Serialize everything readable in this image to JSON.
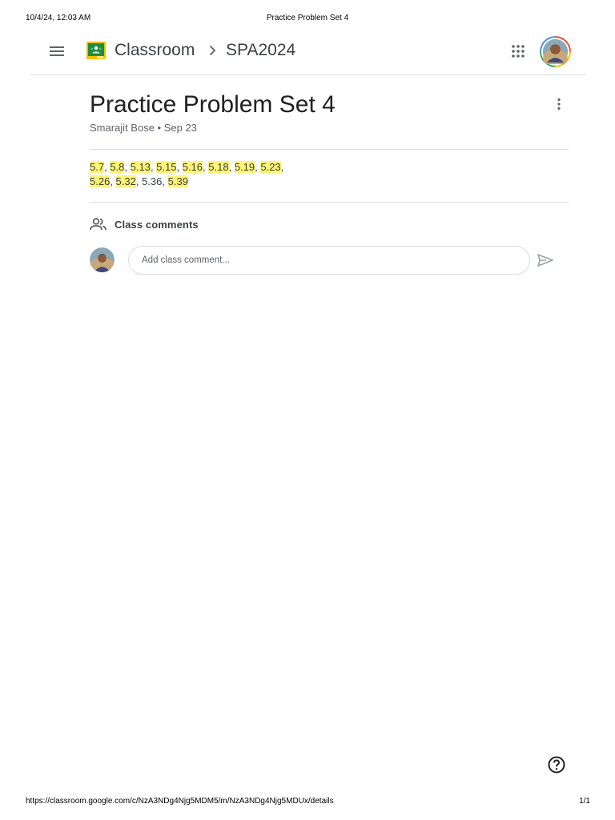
{
  "print_header": {
    "datetime": "10/4/24, 12:03 AM",
    "title": "Practice Problem Set 4"
  },
  "topbar": {
    "app_name": "Classroom",
    "course": "SPA2024"
  },
  "post": {
    "title": "Practice Problem Set 4",
    "author": "Smarajit Bose",
    "date": "Sep 23"
  },
  "problems": [
    {
      "text": "5.7",
      "highlighted": true
    },
    {
      "text": "5.8",
      "highlighted": true
    },
    {
      "text": "5.13",
      "highlighted": true
    },
    {
      "text": "5.15",
      "highlighted": true
    },
    {
      "text": "5.16",
      "highlighted": true
    },
    {
      "text": "5.18",
      "highlighted": true
    },
    {
      "text": "5.19",
      "highlighted": true
    },
    {
      "text": "5.23",
      "highlighted": true
    },
    {
      "text": "5.26",
      "highlighted": true
    },
    {
      "text": "5.32",
      "highlighted": true
    },
    {
      "text": "5.36",
      "highlighted": false
    },
    {
      "text": "5.39",
      "highlighted": true
    }
  ],
  "comments": {
    "label": "Class comments",
    "placeholder": "Add class comment..."
  },
  "print_footer": {
    "url": "https://classroom.google.com/c/NzA3NDg4Njg5MDM5/m/NzA3NDg4Njg5MDUx/details",
    "page": "1/1"
  },
  "colors": {
    "highlight": "#fff475",
    "divider": "#dadce0",
    "logo_green": "#1e8e3e",
    "logo_yellow": "#fbbc04"
  },
  "icons": [
    "hamburger-menu-icon",
    "classroom-logo-icon",
    "chevron-right-icon",
    "apps-grid-icon",
    "more-vert-icon",
    "people-icon",
    "send-icon",
    "help-icon"
  ]
}
